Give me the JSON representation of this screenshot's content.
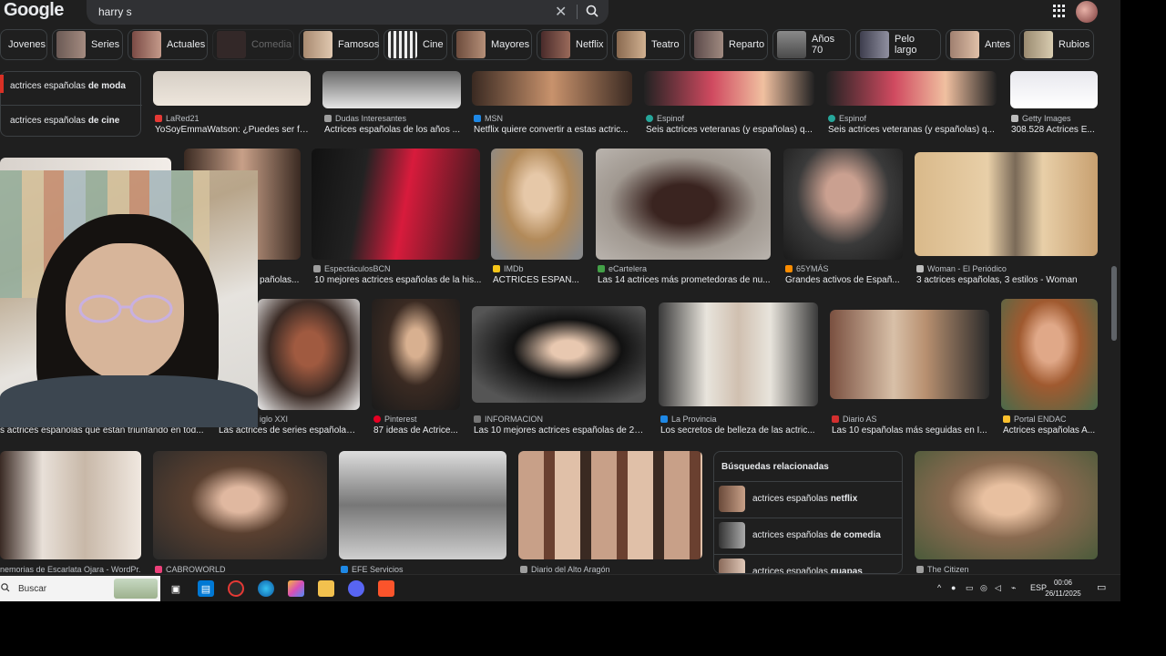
{
  "header": {
    "logo": "Google",
    "search_query": "harry s",
    "clear_label": "✕"
  },
  "chips": [
    {
      "label": "Jovenes",
      "has_thumb": false
    },
    {
      "label": "Series",
      "has_thumb": true,
      "color": "#6b5a55"
    },
    {
      "label": "Actuales",
      "has_thumb": true,
      "color": "#7b4b45"
    },
    {
      "label": "Comedia",
      "has_thumb": true,
      "color": "#5a3a3a"
    },
    {
      "label": "Famosos",
      "has_thumb": true,
      "color": "#a88a70"
    },
    {
      "label": "Cine",
      "has_thumb": true,
      "color": "#777777"
    },
    {
      "label": "Mayores",
      "has_thumb": true,
      "color": "#6d4c3d"
    },
    {
      "label": "Netflix",
      "has_thumb": true,
      "color": "#4a2b2b"
    },
    {
      "label": "Teatro",
      "has_thumb": true,
      "color": "#8a6a50"
    },
    {
      "label": "Reparto",
      "has_thumb": true,
      "color": "#5b4a4a"
    },
    {
      "label": "Años 70",
      "has_thumb": true,
      "color": "#8a8a8a"
    },
    {
      "label": "Pelo largo",
      "has_thumb": true,
      "color": "#3e3e4e"
    },
    {
      "label": "Antes",
      "has_thumb": true,
      "color": "#a08070"
    },
    {
      "label": "Rubios",
      "has_thumb": true,
      "color": "#9a8a70"
    }
  ],
  "sidebar": {
    "items": [
      {
        "prefix": "actrices españolas",
        "bold": "de moda"
      },
      {
        "prefix": "actrices españolas",
        "bold": "de cine"
      }
    ]
  },
  "row1": [
    {
      "source": "LaRed21",
      "caption": "YoSoyEmmaWatson: ¿Puedes ser fe...",
      "fav": "#e53935"
    },
    {
      "source": "Dudas Interesantes",
      "caption": "Actrices españolas de los años ...",
      "fav": "#9e9e9e"
    },
    {
      "source": "MSN",
      "caption": "Netflix quiere convertir a estas actric...",
      "fav": "#1e88e5"
    },
    {
      "source": "Espinof",
      "caption": "Seis actrices veteranas (y españolas) q...",
      "fav": "#26a69a"
    },
    {
      "source": "Espinof",
      "caption": "Seis actrices veteranas (y españolas) q...",
      "fav": "#26a69a"
    },
    {
      "source": "Getty Images",
      "caption": "308.528 Actrices E...",
      "fav": "#bdbdbd"
    }
  ],
  "row2": [
    {
      "source": "",
      "caption": "pañolas...",
      "fav": "#000000"
    },
    {
      "source": "EspectáculosBCN",
      "caption": "10 mejores actrices españolas de la his...",
      "fav": "#9e9e9e"
    },
    {
      "source": "IMDb",
      "caption": "ACTRICES ESPAÑ...",
      "fav": "#f5c518"
    },
    {
      "source": "eCartelera",
      "caption": "Las 14 actrices más prometedoras de nu...",
      "fav": "#43a047"
    },
    {
      "source": "65YMÁS",
      "caption": "Grandes activos de Españ...",
      "fav": "#fb8c00"
    },
    {
      "source": "Woman - El Periódico",
      "caption": "3 actrices españolas, 3 estilos - Woman",
      "fav": "#bdbdbd"
    }
  ],
  "row3": [
    {
      "source": "",
      "caption": "s actrices españolas que están triunfando en tod...",
      "fav": "#000000"
    },
    {
      "source": "iglo XXI",
      "caption": "Las actrices de series españolas ...",
      "fav": "#000000"
    },
    {
      "source": "Pinterest",
      "caption": "87 ideas de Actrice...",
      "fav": "#e60023"
    },
    {
      "source": "INFORMACION",
      "caption": "Las 10 mejores actrices españolas de 2015",
      "fav": "#757575"
    },
    {
      "source": "La Provincia",
      "caption": "Los secretos de belleza de las actric...",
      "fav": "#1e88e5"
    },
    {
      "source": "Diario AS",
      "caption": "Las 10 españolas más seguidas en I...",
      "fav": "#d32f2f"
    },
    {
      "source": "Portal ENDAC",
      "caption": "Actrices españolas A...",
      "fav": "#fbc02d"
    }
  ],
  "row4": [
    {
      "source": "nemorias de Escarlata Ojara - WordPr...",
      "fav": "#000000"
    },
    {
      "source": "CABROWORLD",
      "fav": "#ec407a"
    },
    {
      "source": "EFE Servicios",
      "fav": "#1e88e5"
    },
    {
      "source": "Diario del Alto Aragón",
      "fav": "#9e9e9e"
    },
    {
      "source": "The Citizen",
      "fav": "#9e9e9e"
    }
  ],
  "related": {
    "title": "Búsquedas relacionadas",
    "items": [
      {
        "prefix": "actrices españolas",
        "bold": "netflix"
      },
      {
        "prefix": "actrices españolas",
        "bold": "de comedia"
      },
      {
        "prefix": "actrices españolas",
        "bold": "guapas"
      }
    ]
  },
  "taskbar": {
    "search_label": "Buscar",
    "lang": "ESP",
    "time": "00:06",
    "date": "26/11/2025"
  }
}
